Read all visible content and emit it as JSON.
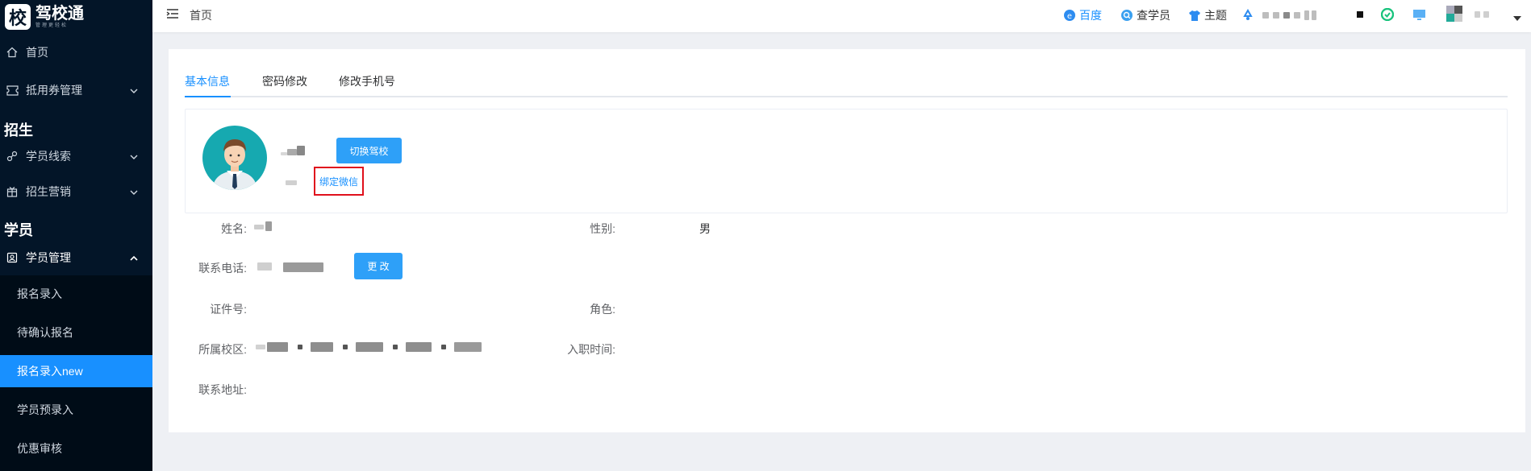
{
  "app": {
    "logo_char": "校",
    "name": "驾校通",
    "slogan": "管理更轻松"
  },
  "sidebar": {
    "items": [
      {
        "label": "首页"
      },
      {
        "label": "抵用券管理"
      }
    ],
    "section_enroll": "招生",
    "enroll_items": [
      {
        "label": "学员线索"
      },
      {
        "label": "招生营销"
      }
    ],
    "section_student": "学员",
    "student_mgmt": {
      "label": "学员管理"
    },
    "sub_items": [
      {
        "label": "报名录入"
      },
      {
        "label": "待确认报名"
      },
      {
        "label": "报名录入new"
      },
      {
        "label": "学员预录入"
      },
      {
        "label": "优惠审核"
      }
    ]
  },
  "header": {
    "breadcrumb": "首页",
    "links": {
      "baidu": "百度",
      "find_student": "查学员",
      "theme": "主题"
    }
  },
  "tabs": [
    {
      "label": "基本信息"
    },
    {
      "label": "密码修改"
    },
    {
      "label": "修改手机号"
    }
  ],
  "profile": {
    "switch_school_button": "切换驾校",
    "bind_wechat_link": "绑定微信"
  },
  "fields": {
    "name_label": "姓名:",
    "gender_label": "性别:",
    "gender_value": "男",
    "phone_label": "联系电话:",
    "change_button": "更 改",
    "id_label": "证件号:",
    "role_label": "角色:",
    "campus_label": "所属校区:",
    "hire_label": "入职时间:",
    "address_label": "联系地址:"
  },
  "colors": {
    "sidebar_bg": "#031528",
    "accent": "#1890ff",
    "highlight_box": "#e0101c"
  }
}
